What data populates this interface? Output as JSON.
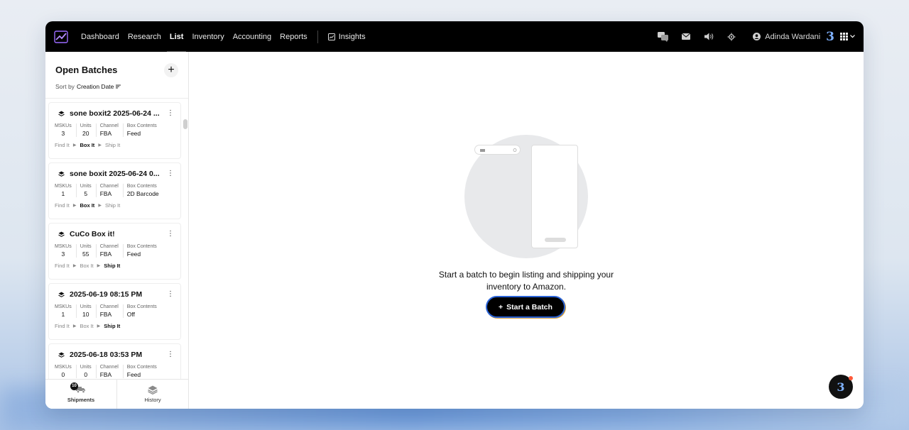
{
  "nav": {
    "links": [
      {
        "label": "Dashboard"
      },
      {
        "label": "Research"
      },
      {
        "label": "List"
      },
      {
        "label": "Inventory"
      },
      {
        "label": "Accounting"
      },
      {
        "label": "Reports"
      }
    ],
    "active": "List",
    "insights_label": "Insights",
    "user_name": "Adinda Wardani",
    "brand_glyph": "3"
  },
  "sidebar": {
    "title": "Open Batches",
    "sort_prefix": "Sort by",
    "sort_value": "Creation Date",
    "stat_labels": {
      "mskus": "MSKUs",
      "units": "Units",
      "channel": "Channel",
      "box_contents": "Box Contents"
    },
    "steps": [
      "Find It",
      "Box It",
      "Ship It"
    ],
    "batches": [
      {
        "name": "sone boxit2 2025-06-24 ...",
        "mskus": "3",
        "units": "20",
        "channel": "FBA",
        "box_contents": "Feed",
        "active_step": "Box It"
      },
      {
        "name": "sone boxit 2025-06-24 0...",
        "mskus": "1",
        "units": "5",
        "channel": "FBA",
        "box_contents": "2D Barcode",
        "active_step": "Box It"
      },
      {
        "name": "CuCo Box it!",
        "mskus": "3",
        "units": "55",
        "channel": "FBA",
        "box_contents": "Feed",
        "active_step": "Ship It"
      },
      {
        "name": "2025-06-19 08:15 PM",
        "mskus": "1",
        "units": "10",
        "channel": "FBA",
        "box_contents": "Off",
        "active_step": "Ship It"
      },
      {
        "name": "2025-06-18 03:53 PM",
        "mskus": "0",
        "units": "0",
        "channel": "FBA",
        "box_contents": "Feed",
        "active_step": ""
      }
    ],
    "footer": {
      "shipments_label": "Shipments",
      "shipments_badge": "10",
      "history_label": "History"
    }
  },
  "main": {
    "empty_line1": "Start a batch to begin listing and shipping your",
    "empty_line2": "inventory to Amazon.",
    "start_button": "Start a Batch"
  },
  "colors": {
    "nav_bg": "#000000",
    "accent_blue": "#2a63d8",
    "accent_gold": "#d8a23a",
    "notification_dot": "#ff5a3a"
  }
}
